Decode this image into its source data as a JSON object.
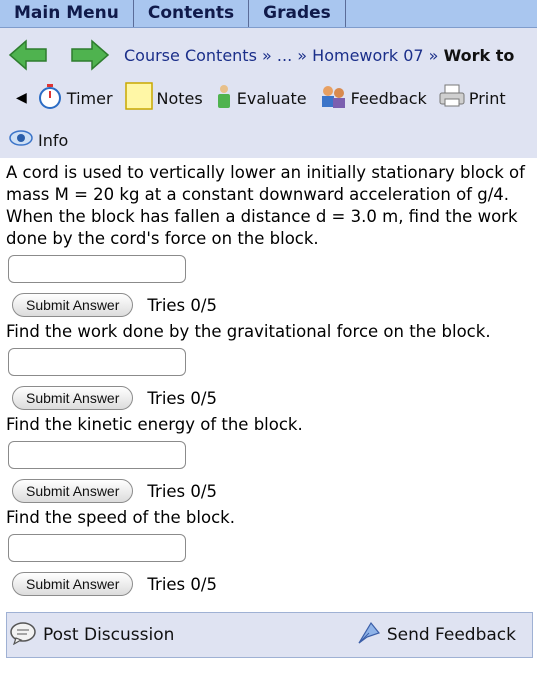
{
  "menu": {
    "items": [
      "Main Menu",
      "Contents",
      "Grades"
    ]
  },
  "nav": {
    "breadcrumb": {
      "course": "Course Contents",
      "sep1": "»",
      "ellipsis": "...",
      "sep2": "»",
      "hw": "Homework 07",
      "sep3": "»",
      "current": "Work to"
    },
    "tools": {
      "timer": "Timer",
      "notes": "Notes",
      "evaluate": "Evaluate",
      "feedback": "Feedback",
      "print": "Print",
      "info": "Info"
    }
  },
  "questions": [
    {
      "text": "A cord is used to vertically lower an initially stationary block of mass M = 20 kg at a constant downward acceleration of g/4. When the block has fallen a distance d = 3.0 m, find the work done by the cord's force on the block.",
      "value": "",
      "submit": "Submit Answer",
      "tries": "Tries 0/5"
    },
    {
      "text": "Find the work done by the gravitational force on the block.",
      "value": "",
      "submit": "Submit Answer",
      "tries": "Tries 0/5"
    },
    {
      "text": "Find the kinetic energy of the block.",
      "value": "",
      "submit": "Submit Answer",
      "tries": "Tries 0/5"
    },
    {
      "text": "Find the speed of the block.",
      "value": "",
      "submit": "Submit Answer",
      "tries": "Tries 0/5"
    }
  ],
  "footer": {
    "post": "Post Discussion",
    "send": "Send Feedback"
  },
  "colors": {
    "menubar": "#a9c6ef",
    "nav": "#dfe3f2",
    "arrow": "#4fb34f",
    "link": "#1b2f8a"
  }
}
